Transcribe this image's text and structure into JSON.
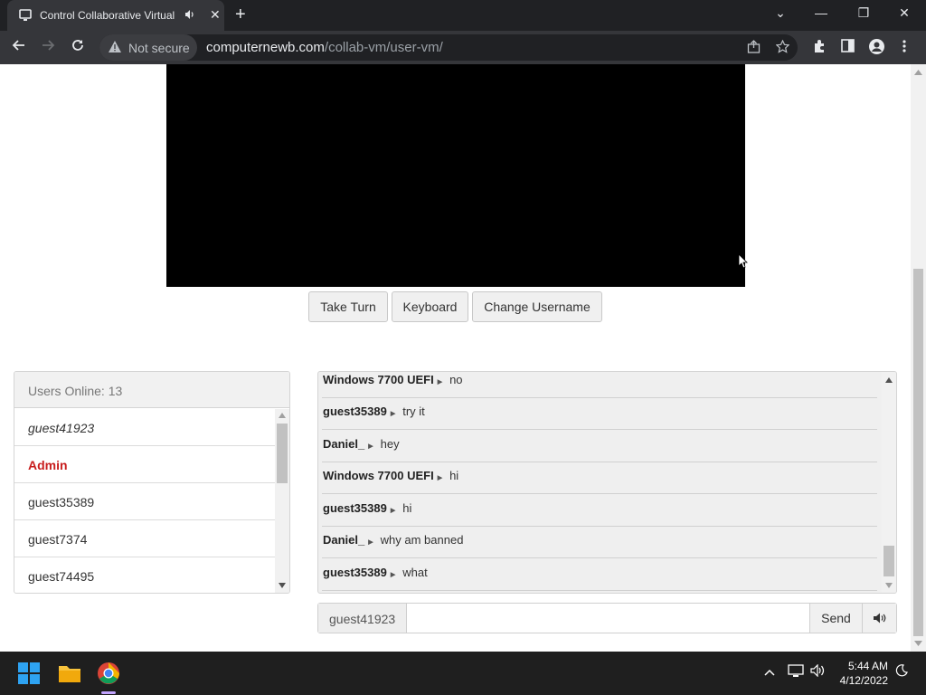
{
  "browser": {
    "tab_title": "Control Collaborative Virtual",
    "audio_icon": "♪",
    "close_icon": "✕",
    "newtab_icon": "+",
    "win_min": "—",
    "win_restore": "❐",
    "win_close": "✕",
    "win_chevron": "⌄",
    "security_label": "Not secure",
    "url_host": "computernewb.com",
    "url_path": "/collab-vm/user-vm/"
  },
  "vm": {
    "buttons": [
      "Take Turn",
      "Keyboard",
      "Change Username"
    ]
  },
  "users": {
    "header": "Users Online: 13",
    "list": [
      {
        "name": "guest41923"
      },
      {
        "name": "Admin"
      },
      {
        "name": "guest35389"
      },
      {
        "name": "guest7374"
      },
      {
        "name": "guest74495"
      }
    ]
  },
  "chat": {
    "messages": [
      {
        "user": "Windows 7700 UEFI",
        "text": "no"
      },
      {
        "user": "guest35389",
        "text": "try it"
      },
      {
        "user": "Daniel_",
        "text": "hey"
      },
      {
        "user": "Windows 7700 UEFI",
        "text": "hi"
      },
      {
        "user": "guest35389",
        "text": "hi"
      },
      {
        "user": "Daniel_",
        "text": "why am banned"
      },
      {
        "user": "guest35389",
        "text": "what"
      }
    ],
    "username": "guest41923",
    "input_value": "",
    "send_label": "Send"
  },
  "taskbar": {
    "time": "5:44 AM",
    "date": "4/12/2022"
  },
  "colors": {
    "admin": "#c81d1d",
    "chrome_dark": "#202124",
    "chrome_toolbar": "#35363a"
  }
}
